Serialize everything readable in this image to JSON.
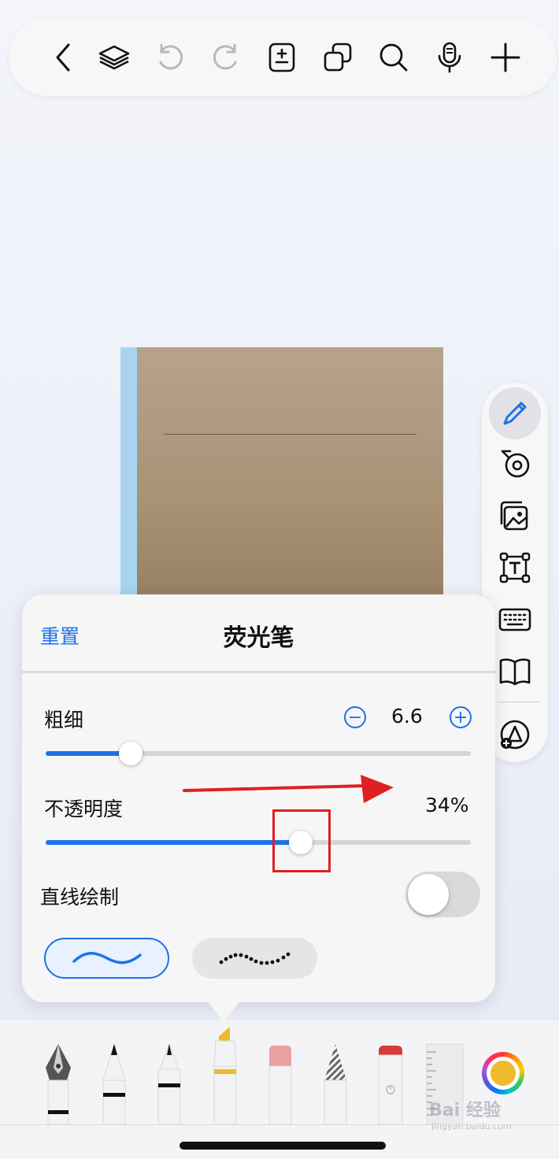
{
  "panel": {
    "reset_label": "重置",
    "title": "荧光笔",
    "thickness": {
      "label": "粗细",
      "value": "6.6",
      "fraction": 0.2
    },
    "opacity": {
      "label": "不透明度",
      "value": "34%",
      "fraction": 0.6
    },
    "straight_line": {
      "label": "直线绘制",
      "enabled": false
    },
    "stroke_styles": [
      "smooth",
      "dotted"
    ],
    "selected_style": "smooth"
  },
  "toolbar_icons": [
    "back-icon",
    "layers-icon",
    "undo-icon",
    "redo-icon",
    "page-add-icon",
    "duplicate-icon",
    "search-icon",
    "microphone-icon",
    "plus-icon"
  ],
  "side_tools": [
    "pen-icon",
    "tape-icon",
    "image-icon",
    "text-box-icon",
    "keyboard-icon",
    "book-icon",
    "shapes-add-icon"
  ],
  "bottom_tools": [
    "fountain-pen",
    "ballpoint-pen",
    "fineliner",
    "highlighter",
    "eraser",
    "pencil",
    "marker",
    "ruler"
  ],
  "selected_tool": "highlighter",
  "selected_color": "#f0b92e",
  "colors": {
    "accent": "#1a73e8",
    "annotation": "#e02020"
  },
  "watermark": {
    "text": "Bai 经验",
    "url": "jingyan.baidu.com"
  }
}
